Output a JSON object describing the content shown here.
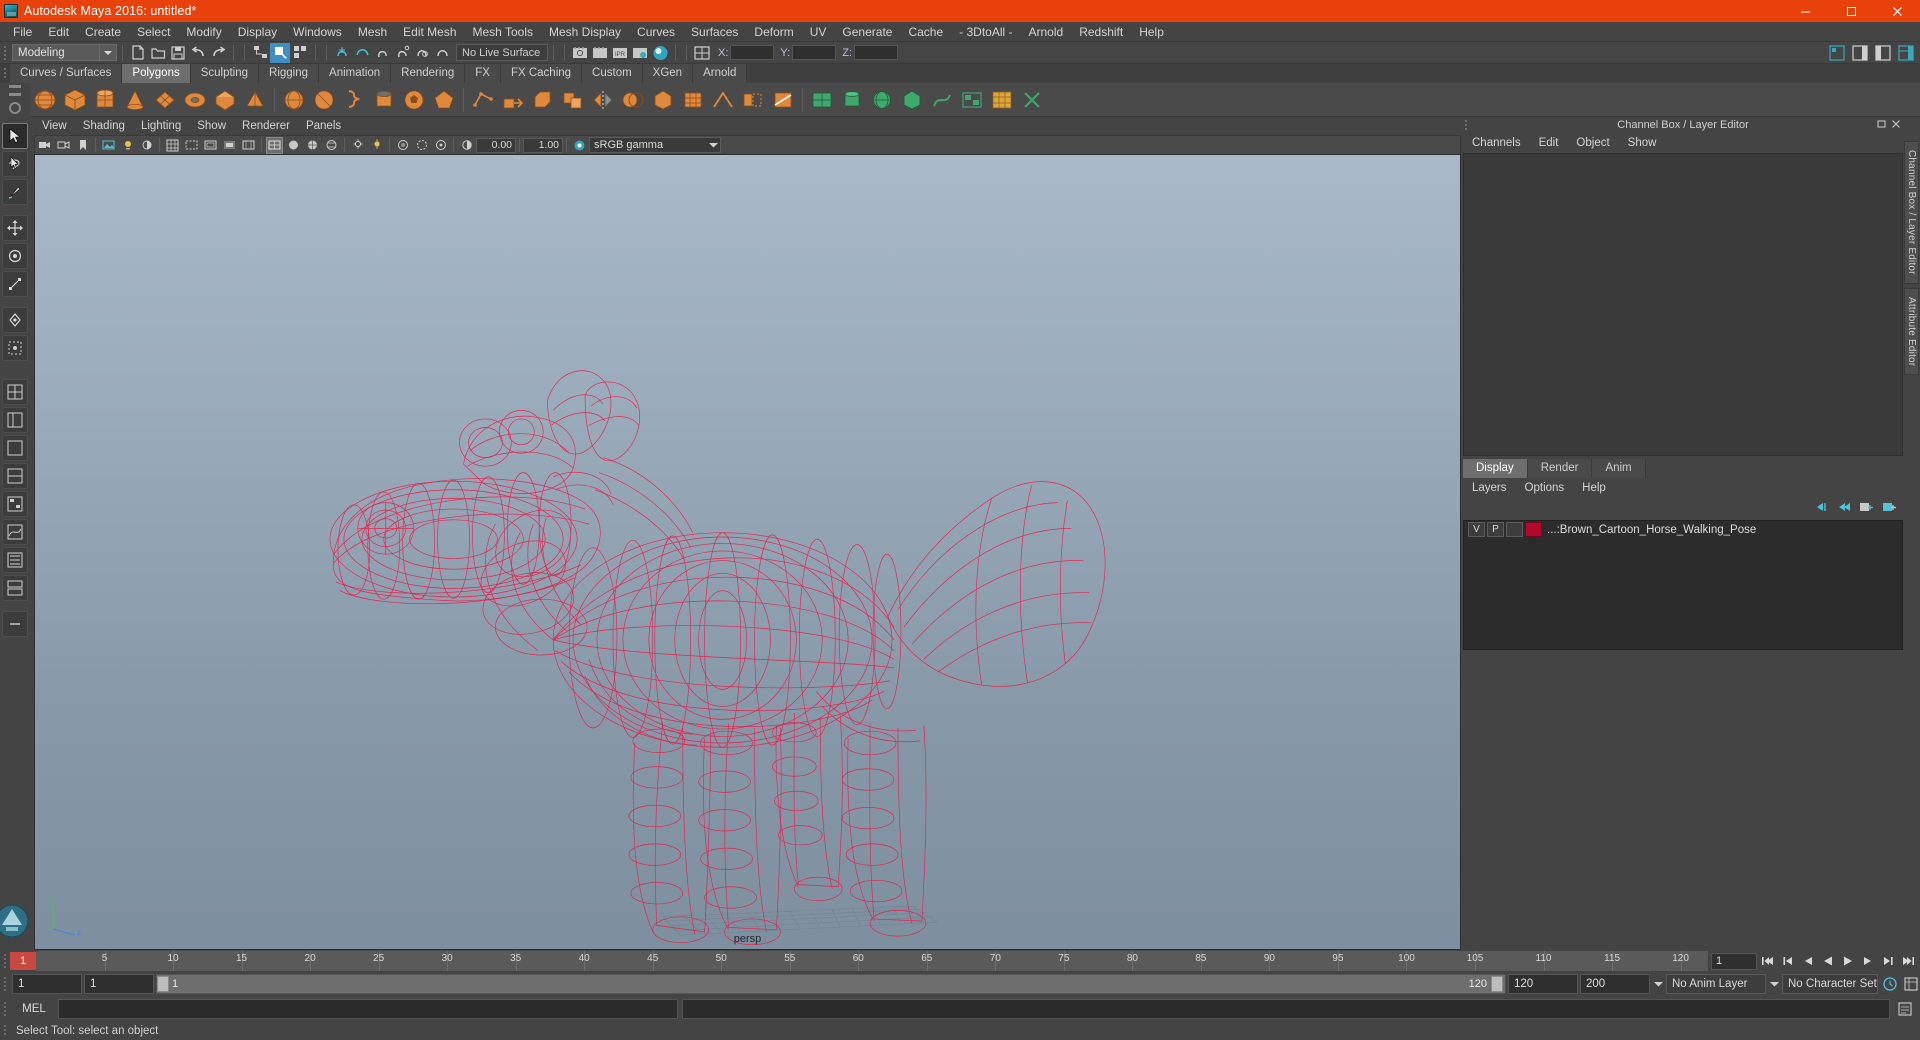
{
  "window": {
    "title": "Autodesk Maya 2016: untitled*",
    "app_icon": "maya-icon",
    "minimize_label": "—",
    "maximize_label": "❐",
    "close_label": "✕",
    "title_bar_color": "#e8410c"
  },
  "menubar": {
    "items": [
      {
        "label": "File"
      },
      {
        "label": "Edit"
      },
      {
        "label": "Create"
      },
      {
        "label": "Select"
      },
      {
        "label": "Modify"
      },
      {
        "label": "Display"
      },
      {
        "label": "Windows"
      },
      {
        "label": "Mesh"
      },
      {
        "label": "Edit Mesh"
      },
      {
        "label": "Mesh Tools"
      },
      {
        "label": "Mesh Display"
      },
      {
        "label": "Curves"
      },
      {
        "label": "Surfaces"
      },
      {
        "label": "Deform"
      },
      {
        "label": "UV"
      },
      {
        "label": "Generate"
      },
      {
        "label": "Cache"
      },
      {
        "label": "- 3DtoAll -"
      },
      {
        "label": "Arnold"
      },
      {
        "label": "Redshift"
      },
      {
        "label": "Help"
      }
    ]
  },
  "toolbar": {
    "mode_menu_value": "Modeling",
    "live_surface_value": "No Live Surface",
    "coord_x_label": "X:",
    "coord_y_label": "Y:",
    "coord_z_label": "Z:",
    "coord_x_value": "",
    "coord_y_value": "",
    "coord_z_value": ""
  },
  "shelf": {
    "tabs": [
      {
        "label": "Curves / Surfaces",
        "selected": false
      },
      {
        "label": "Polygons",
        "selected": true
      },
      {
        "label": "Sculpting",
        "selected": false
      },
      {
        "label": "Rigging",
        "selected": false
      },
      {
        "label": "Animation",
        "selected": false
      },
      {
        "label": "Rendering",
        "selected": false
      },
      {
        "label": "FX",
        "selected": false
      },
      {
        "label": "FX Caching",
        "selected": false
      },
      {
        "label": "Custom",
        "selected": false
      },
      {
        "label": "XGen",
        "selected": false
      },
      {
        "label": "Arnold",
        "selected": false
      }
    ]
  },
  "viewport": {
    "menus": [
      {
        "label": "View"
      },
      {
        "label": "Shading"
      },
      {
        "label": "Lighting"
      },
      {
        "label": "Show"
      },
      {
        "label": "Renderer"
      },
      {
        "label": "Panels"
      }
    ],
    "exposure_value": "0.00",
    "gamma_value": "1.00",
    "color_management": "sRGB gamma",
    "camera_label": "persp",
    "axis_x_label": "x",
    "axis_y_label": "y",
    "axis_z_label": "z",
    "wireframe_color": "#e8204a",
    "background_top": "#a9b9c9",
    "background_bottom": "#7e8f9f"
  },
  "channel_box": {
    "panel_title": "Channel Box / Layer Editor",
    "menus": [
      {
        "label": "Channels"
      },
      {
        "label": "Edit"
      },
      {
        "label": "Object"
      },
      {
        "label": "Show"
      }
    ]
  },
  "layer_editor": {
    "tabs": [
      {
        "label": "Display",
        "selected": true
      },
      {
        "label": "Render",
        "selected": false
      },
      {
        "label": "Anim",
        "selected": false
      }
    ],
    "menus": [
      {
        "label": "Layers"
      },
      {
        "label": "Options"
      },
      {
        "label": "Help"
      }
    ],
    "layers": [
      {
        "visibility": "V",
        "playback": "P",
        "shading": "",
        "color": "#b8072f",
        "name": "...:Brown_Cartoon_Horse_Walking_Pose"
      }
    ]
  },
  "right_vertical_tabs": [
    {
      "label": "Channel Box / Layer Editor"
    },
    {
      "label": "Attribute Editor"
    }
  ],
  "timeline": {
    "current_frame": "1",
    "ticks": [
      5,
      10,
      15,
      20,
      25,
      30,
      35,
      40,
      45,
      50,
      55,
      60,
      65,
      70,
      75,
      80,
      85,
      90,
      95,
      100,
      105,
      110,
      115,
      120
    ],
    "frame_field": "1",
    "transport_buttons": [
      {
        "name": "go-to-start",
        "glyph": "⏮"
      },
      {
        "name": "step-back-key",
        "glyph": "⏴"
      },
      {
        "name": "step-back-frame",
        "glyph": "◀"
      },
      {
        "name": "play-backwards",
        "glyph": "◀"
      },
      {
        "name": "play-forwards",
        "glyph": "▶"
      },
      {
        "name": "step-forward-frame",
        "glyph": "▶"
      },
      {
        "name": "step-forward-key",
        "glyph": "⏵"
      },
      {
        "name": "go-to-end",
        "glyph": "⏭"
      }
    ]
  },
  "range_slider": {
    "start_time": "1",
    "anim_start": "1",
    "range_left_label": "1",
    "range_right_label": "120",
    "anim_end": "120",
    "end_time": "200",
    "anim_layer": "No Anim Layer",
    "character_set": "No Character Set"
  },
  "command_line": {
    "language_label": "MEL",
    "input_value": "",
    "output_value": ""
  },
  "status_bar": {
    "message": "Select Tool: select an object"
  }
}
